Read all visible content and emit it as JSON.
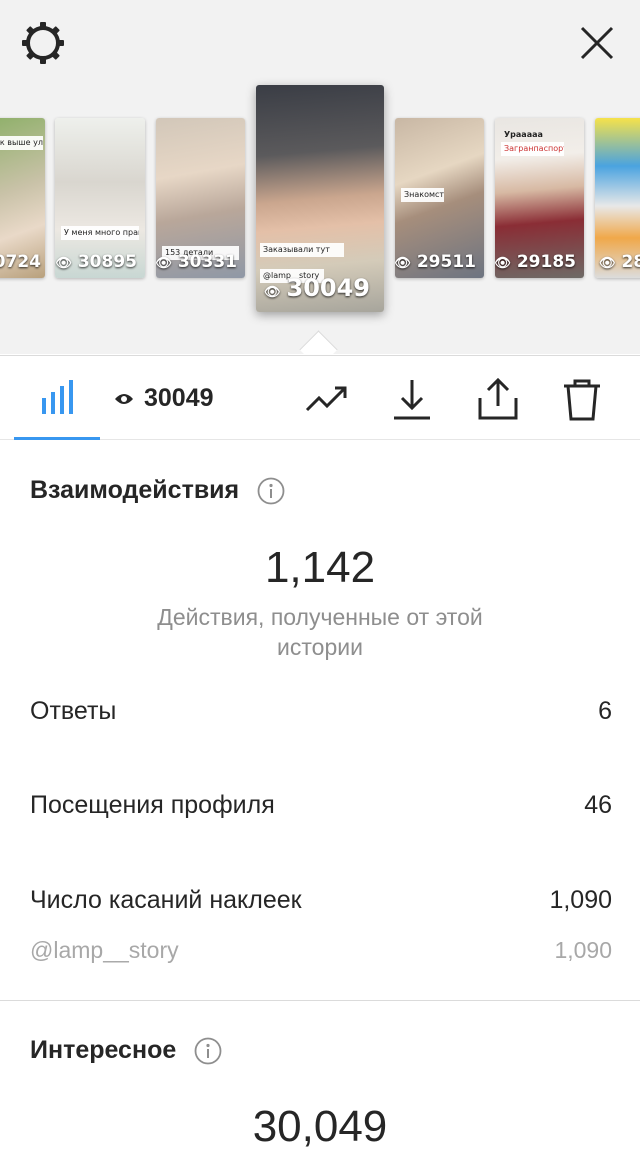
{
  "colors": {
    "accent": "#3897f0",
    "text": "#262626",
    "muted": "#8e8e8e",
    "top_bg": "#f2f2f2"
  },
  "header": {
    "settings_icon": "gear-icon",
    "close_icon": "close-icon"
  },
  "stories": [
    {
      "views": "0724",
      "caption": "ок выше улицы",
      "selected": false
    },
    {
      "views": "30895",
      "caption": "У меня много правильно:",
      "selected": false
    },
    {
      "views": "30331",
      "caption": "153 детали",
      "selected": false
    },
    {
      "views": "30049",
      "caption": "Заказывали тут",
      "caption2": "@lamp__story",
      "selected": true
    },
    {
      "views": "29511",
      "caption": "Знакомство",
      "selected": false
    },
    {
      "views": "29185",
      "caption": "Загранпаспорта",
      "caption_top": "Урааааа",
      "selected": false
    },
    {
      "views": "28",
      "caption": "",
      "selected": false
    }
  ],
  "toolbar": {
    "views": "30049",
    "icons": [
      "bar-chart-icon",
      "trend-icon",
      "download-icon",
      "share-icon",
      "trash-icon"
    ]
  },
  "interactions": {
    "title": "Взаимодействия",
    "total": "1,142",
    "total_desc": "Действия, полученные от этой истории",
    "rows": [
      {
        "label": "Ответы",
        "value": "6"
      },
      {
        "label": "Посещения профиля",
        "value": "46"
      },
      {
        "label": "Число касаний наклеек",
        "value": "1,090"
      }
    ],
    "sub_row": {
      "label": "@lamp__story",
      "value": "1,090"
    }
  },
  "discovery": {
    "title": "Интересное",
    "total": "30,049"
  }
}
